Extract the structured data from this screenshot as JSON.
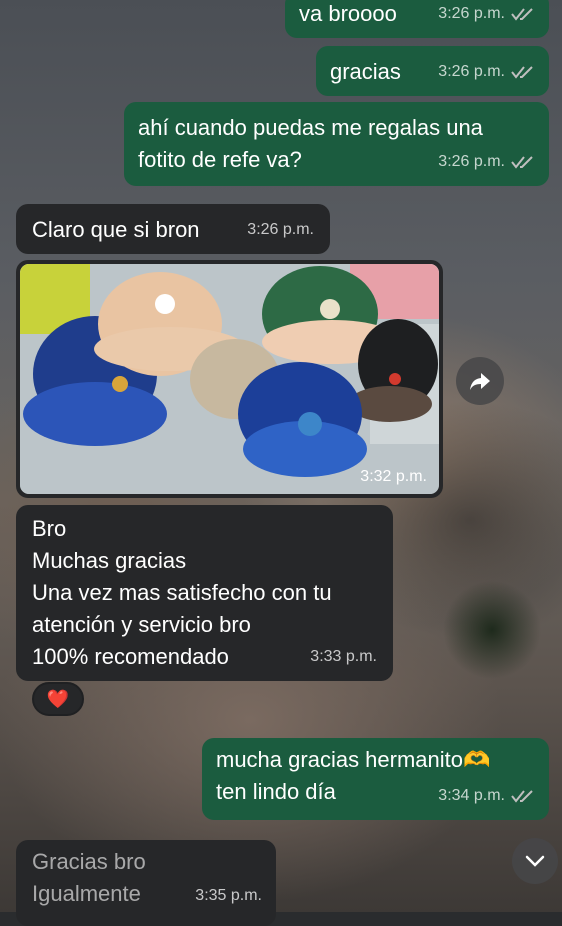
{
  "messages": [
    {
      "id": "m1",
      "dir": "out",
      "text": "va broooo",
      "time": "3:26 p.m."
    },
    {
      "id": "m2",
      "dir": "out",
      "text": "gracias",
      "time": "3:26 p.m."
    },
    {
      "id": "m3",
      "dir": "out",
      "text": "ahí cuando puedas me regalas una\nfotito de refe va?",
      "time": "3:26 p.m."
    },
    {
      "id": "m4",
      "dir": "in",
      "text": "Claro que si bron",
      "time": "3:26 p.m."
    },
    {
      "id": "m5",
      "dir": "in",
      "type": "image",
      "time": "3:32 p.m."
    },
    {
      "id": "m6",
      "dir": "in",
      "text": "Bro\nMuchas gracias\nUna vez mas satisfecho con tu\natención y servicio bro\n100% recomendado",
      "time": "3:33 p.m.",
      "reaction": "❤️"
    },
    {
      "id": "m7",
      "dir": "out",
      "text": "mucha gracias hermanito🫶\nten lindo día",
      "time": "3:34 p.m."
    },
    {
      "id": "m8",
      "dir": "in",
      "text": "Gracias bro\nIgualmente",
      "time": "3:35 p.m."
    }
  ],
  "icons": {
    "read_receipt": "double-check-icon",
    "forward": "forward-arrow-icon",
    "scroll_down": "chevron-down-icon"
  },
  "colors": {
    "outgoing_bubble": "#1b5c3f",
    "incoming_bubble": "#262729",
    "meta_text": "#bfbfbf"
  }
}
